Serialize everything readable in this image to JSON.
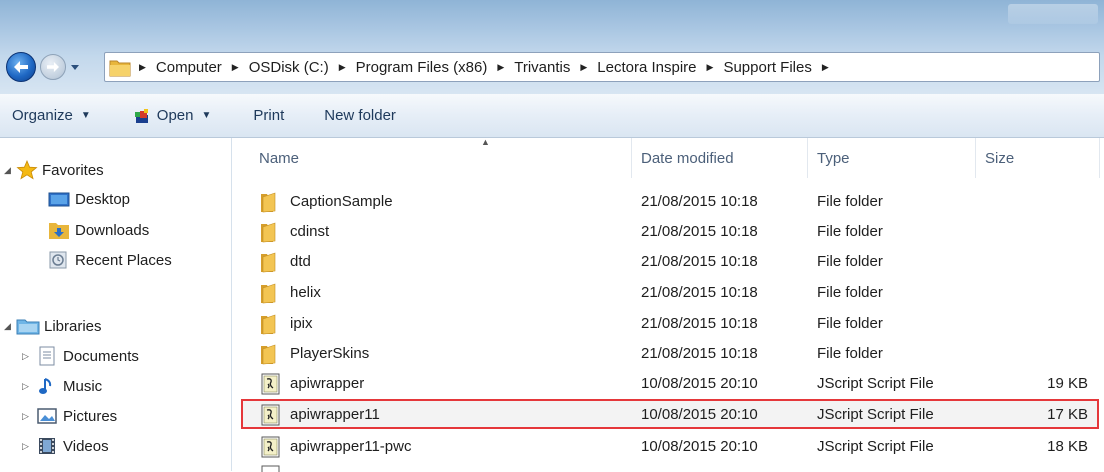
{
  "address": {
    "breadcrumbs": [
      "Computer",
      "OSDisk (C:)",
      "Program Files (x86)",
      "Trivantis",
      "Lectora Inspire",
      "Support Files"
    ]
  },
  "toolbar": {
    "organize_label": "Organize",
    "open_label": "Open",
    "print_label": "Print",
    "new_folder_label": "New folder"
  },
  "nav": {
    "favorites": {
      "label": "Favorites",
      "items": [
        "Desktop",
        "Downloads",
        "Recent Places"
      ]
    },
    "libraries": {
      "label": "Libraries",
      "items": [
        "Documents",
        "Music",
        "Pictures",
        "Videos"
      ]
    }
  },
  "columns": {
    "name": "Name",
    "date": "Date modified",
    "type": "Type",
    "size": "Size"
  },
  "files": [
    {
      "name": "CaptionSample",
      "date": "21/08/2015 10:18",
      "type": "File folder",
      "size": "",
      "icon": "folder-icon"
    },
    {
      "name": "cdinst",
      "date": "21/08/2015 10:18",
      "type": "File folder",
      "size": "",
      "icon": "folder-icon"
    },
    {
      "name": "dtd",
      "date": "21/08/2015 10:18",
      "type": "File folder",
      "size": "",
      "icon": "folder-icon"
    },
    {
      "name": "helix",
      "date": "21/08/2015 10:18",
      "type": "File folder",
      "size": "",
      "icon": "folder-icon"
    },
    {
      "name": "ipix",
      "date": "21/08/2015 10:18",
      "type": "File folder",
      "size": "",
      "icon": "folder-icon"
    },
    {
      "name": "PlayerSkins",
      "date": "21/08/2015 10:18",
      "type": "File folder",
      "size": "",
      "icon": "folder-icon"
    },
    {
      "name": "apiwrapper",
      "date": "10/08/2015 20:10",
      "type": "JScript Script File",
      "size": "19 KB",
      "icon": "jscript-file-icon"
    },
    {
      "name": "apiwrapper11",
      "date": "10/08/2015 20:10",
      "type": "JScript Script File",
      "size": "17 KB",
      "icon": "jscript-file-icon"
    },
    {
      "name": "apiwrapper11-pwc",
      "date": "10/08/2015 20:10",
      "type": "JScript Script File",
      "size": "18 KB",
      "icon": "jscript-file-icon"
    }
  ],
  "colors": {
    "highlight_border": "#e5373a",
    "folder": "#e8b63c",
    "accent_blue": "#1f68c4"
  }
}
